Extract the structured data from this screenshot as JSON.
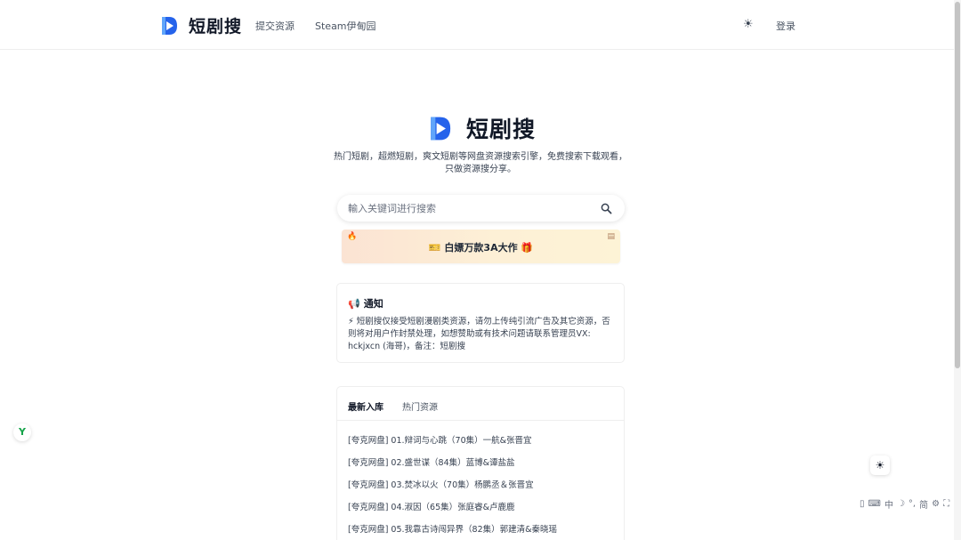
{
  "header": {
    "brand_name": "短剧搜",
    "nav": {
      "submit": "提交资源",
      "steam": "Steam伊甸园"
    },
    "theme_icon": "sun-icon",
    "login": "登录"
  },
  "hero": {
    "brand_name": "短剧搜",
    "tagline_line1": "热门短剧，超燃短剧，爽文短剧等网盘资源搜索引擎，免费搜索下载观看，",
    "tagline_line2": "只做资源搜分享。"
  },
  "search": {
    "placeholder": "輸入关键词进行搜索",
    "value": ""
  },
  "banner": {
    "text": "🎫 白嫖万款3A大作 🎁"
  },
  "notice": {
    "title": "通知",
    "body": "⚡ 短剧搜仅接受短剧漫剧类资源，请勿上传纯引流广告及其它资源，否则将对用户作封禁处理，如想赞助或有技术问题请联系管理员VX: hckjxcn (海哥)，备注：短剧搜"
  },
  "tabs": {
    "latest": "最新入库",
    "hot": "热门资源"
  },
  "items": [
    "[夸克网盘] 01.辩词与心跳（70集）一航&张晋宜",
    "[夸克网盘] 02.盛世谋（84集）蓝博&谭盐盐",
    "[夸克网盘] 03.焚冰以火（70集）杨鹏丞＆张晋宜",
    "[夸克网盘] 04.淑因（65集）张庭睿&卢鹿鹿",
    "[夸克网盘] 05.我靠古诗闯异界（82集）郭建清&秦晓瑶"
  ],
  "ime": {
    "chinese": "中",
    "simplified": "简"
  },
  "colors": {
    "accent_blue": "#2f7cf6",
    "logo_dark": "#1e40af",
    "banner_from": "#fbe3d3",
    "banner_to": "#fdf3d6"
  }
}
